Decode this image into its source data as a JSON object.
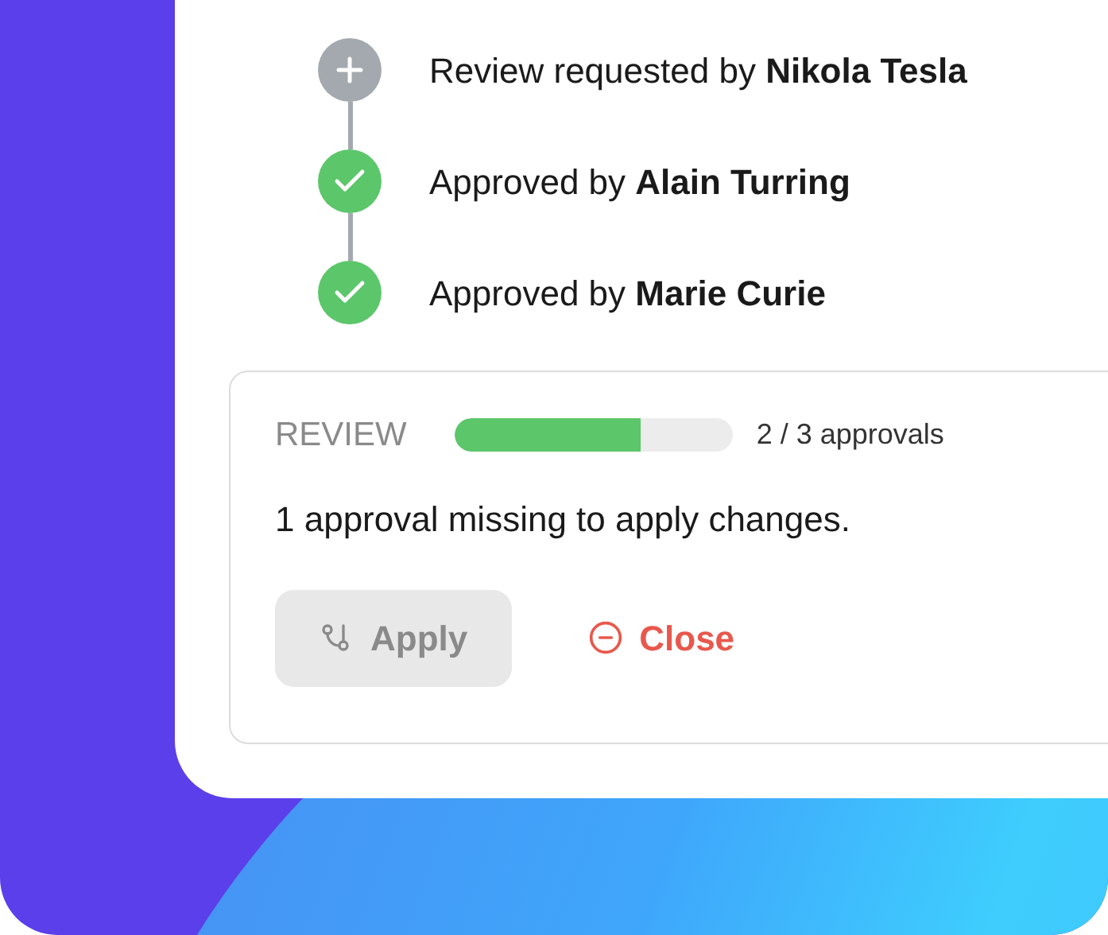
{
  "timeline": [
    {
      "kind": "requested",
      "text": "Review requested by **Nikola Tesla**"
    },
    {
      "kind": "approved",
      "text": "Approved by **Alain Turring**"
    },
    {
      "kind": "approved",
      "text": "Approved by **Marie Curie**"
    }
  ],
  "review": {
    "label": "REVIEW",
    "progress": {
      "level": 0.667
    },
    "count": "2 / 3 approvals",
    "message": "1 approval missing to apply changes.",
    "buttons": [
      {
        "kind": "apply",
        "label": "Apply",
        "disabled": true
      },
      {
        "kind": "close",
        "label": "Close",
        "disabled": false
      }
    ]
  }
}
